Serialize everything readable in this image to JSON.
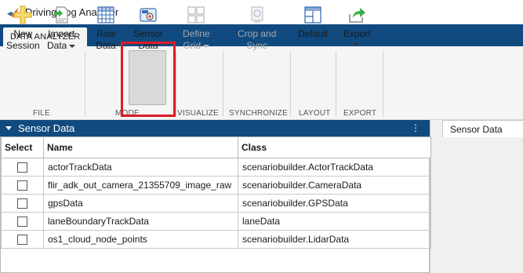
{
  "window": {
    "title": "Driving Log Analyzer",
    "app_icon": "matlab-logo-icon"
  },
  "tabs": [
    {
      "label": "DATA ANALYZER",
      "active": true
    }
  ],
  "toolstrip": {
    "groups": [
      {
        "label": "FILE"
      },
      {
        "label": "MODE"
      },
      {
        "label": "VISUALIZE"
      },
      {
        "label": "SYNCHRONIZE"
      },
      {
        "label": "LAYOUT"
      },
      {
        "label": "EXPORT"
      }
    ],
    "buttons": [
      {
        "line1": "New",
        "line2": "Session",
        "icon": "plus-icon",
        "enabled": true
      },
      {
        "line1": "Import",
        "line2": "Data",
        "icon": "import-icon",
        "enabled": true,
        "dropdown": true
      },
      {
        "line1": "Raw",
        "line2": "Data",
        "icon": "grid-table-icon",
        "enabled": true
      },
      {
        "line1": "Sensor",
        "line2": "Data",
        "icon": "sensor-camera-icon",
        "enabled": true,
        "selected": true
      },
      {
        "line1": "Define",
        "line2": "Grid",
        "icon": "grid-2x2-icon",
        "enabled": false,
        "dropdown": true
      },
      {
        "line1": "Crop and",
        "line2": "Sync",
        "icon": "crop-sync-icon",
        "enabled": false
      },
      {
        "line1": "Default",
        "line2": "",
        "icon": "layout-icon",
        "enabled": true
      },
      {
        "line1": "Export",
        "line2": "",
        "icon": "export-icon",
        "enabled": true,
        "dropdown": true
      }
    ]
  },
  "panel": {
    "title": "Sensor Data",
    "menu_glyph": "⋮"
  },
  "right_tab": {
    "label": "Sensor Data"
  },
  "table": {
    "columns": [
      "Select",
      "Name",
      "Class"
    ],
    "rows": [
      {
        "checked": false,
        "name": "actorTrackData",
        "class": "scenariobuilder.ActorTrackData"
      },
      {
        "checked": false,
        "name": "flir_adk_out_camera_21355709_image_raw",
        "class": "scenariobuilder.CameraData"
      },
      {
        "checked": false,
        "name": "gpsData",
        "class": "scenariobuilder.GPSData"
      },
      {
        "checked": false,
        "name": "laneBoundaryTrackData",
        "class": "laneData"
      },
      {
        "checked": false,
        "name": "os1_cloud_node_points",
        "class": "scenariobuilder.LidarData"
      }
    ]
  },
  "colors": {
    "accent_blue": "#104a7f",
    "highlight_red": "#e01b24",
    "toolstrip_bg": "#f5f5f5"
  }
}
